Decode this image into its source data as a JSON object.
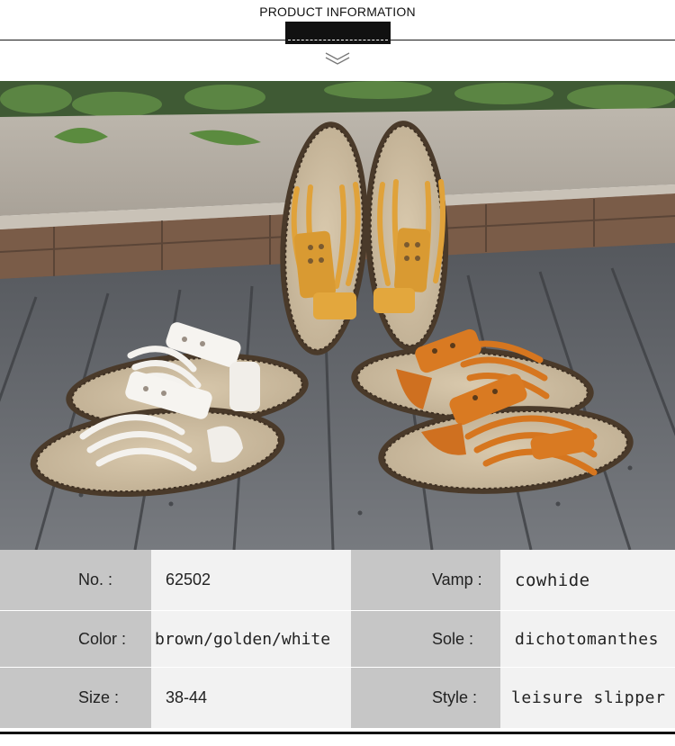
{
  "header": {
    "title": "PRODUCT INFORMATION"
  },
  "photo": {
    "subject": "three pairs of leather toe-loop slippers",
    "colors": {
      "white_strap": "#f4f2ee",
      "brown_strap": "#d6761f",
      "golden_strap": "#e0a23a",
      "footbed": "#cdbba0",
      "stitch": "#4a3a2a",
      "deck": "#6a6c70",
      "brick": "#7a5c48",
      "stone": "#b7b0a6"
    }
  },
  "specs": {
    "rows": [
      {
        "label1": "No. :",
        "value1": "62502",
        "label2": "Vamp :",
        "value2": "cowhide"
      },
      {
        "label1": "Color :",
        "value1": "brown/golden/white",
        "label2": "Sole :",
        "value2": "dichotomanthes"
      },
      {
        "label1": "Size :",
        "value1": "38-44",
        "label2": "Style :",
        "value2": "leisure slipper"
      }
    ]
  }
}
